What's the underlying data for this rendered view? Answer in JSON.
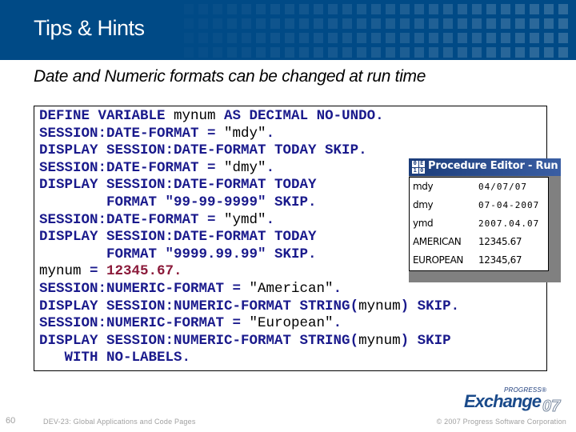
{
  "header": {
    "title": "Tips & Hints",
    "background_color": "#004a86"
  },
  "subtitle": "Date and Numeric formats can be changed at run time",
  "code": {
    "lines": [
      [
        {
          "t": "DEFINE VARIABLE ",
          "c": "kw"
        },
        {
          "t": "mynum",
          "c": "id"
        },
        {
          "t": " AS DECIMAL NO-UNDO.",
          "c": "kw"
        }
      ],
      [
        {
          "t": "SESSION:DATE-FORMAT = ",
          "c": "kw"
        },
        {
          "t": "\"mdy\"",
          "c": "str"
        },
        {
          "t": ".",
          "c": "kw"
        }
      ],
      [
        {
          "t": "DISPLAY SESSION:DATE-FORMAT TODAY SKIP.",
          "c": "kw"
        }
      ],
      [
        {
          "t": "SESSION:DATE-FORMAT = ",
          "c": "kw"
        },
        {
          "t": "\"dmy\"",
          "c": "str"
        },
        {
          "t": ".",
          "c": "kw"
        }
      ],
      [
        {
          "t": "DISPLAY SESSION:DATE-FORMAT TODAY",
          "c": "kw"
        }
      ],
      [
        {
          "t": "        FORMAT \"99-99-9999\" SKIP.",
          "c": "fmt"
        }
      ],
      [
        {
          "t": "SESSION:DATE-FORMAT = ",
          "c": "kw"
        },
        {
          "t": "\"ymd\"",
          "c": "str"
        },
        {
          "t": ".",
          "c": "kw"
        }
      ],
      [
        {
          "t": "DISPLAY SESSION:DATE-FORMAT TODAY",
          "c": "kw"
        }
      ],
      [
        {
          "t": "        FORMAT \"9999.99.99\" SKIP.",
          "c": "fmt"
        }
      ],
      [
        {
          "t": "mynum",
          "c": "id"
        },
        {
          "t": " = ",
          "c": "kw"
        },
        {
          "t": "12345.67.",
          "c": "num"
        }
      ],
      [
        {
          "t": "SESSION:NUMERIC-FORMAT = ",
          "c": "kw"
        },
        {
          "t": "\"American\"",
          "c": "str"
        },
        {
          "t": ".",
          "c": "kw"
        }
      ],
      [
        {
          "t": "DISPLAY SESSION:NUMERIC-FORMAT STRING(",
          "c": "kw"
        },
        {
          "t": "mynum",
          "c": "id"
        },
        {
          "t": ") SKIP.",
          "c": "kw"
        }
      ],
      [
        {
          "t": "SESSION:NUMERIC-FORMAT = ",
          "c": "kw"
        },
        {
          "t": "\"European\"",
          "c": "str"
        },
        {
          "t": ".",
          "c": "kw"
        }
      ],
      [
        {
          "t": "DISPLAY SESSION:NUMERIC-FORMAT STRING(",
          "c": "kw"
        },
        {
          "t": "mynum",
          "c": "id"
        },
        {
          "t": ") SKIP",
          "c": "kw"
        }
      ],
      [
        {
          "t": "   WITH NO-LABELS.",
          "c": "kw"
        }
      ]
    ],
    "colors": {
      "keyword": "#1a1a8c",
      "identifier": "#000000",
      "number_literal": "#8b1a3a"
    }
  },
  "procedure_window": {
    "icon": "progress-0e10-icon",
    "icon_glyphs": [
      "0",
      "E",
      "1",
      "0"
    ],
    "title": "Procedure Editor - Run",
    "rows": [
      {
        "label": "mdy",
        "value": "04/07/07",
        "style": "mono"
      },
      {
        "label": "dmy",
        "value": "07-04-2007",
        "style": "mono"
      },
      {
        "label": "ymd",
        "value": "2007.04.07",
        "style": "mono"
      },
      {
        "label": "AMERICAN",
        "value": "12345.67",
        "style": "prop"
      },
      {
        "label": "EUROPEAN",
        "value": "12345,67",
        "style": "prop"
      }
    ]
  },
  "footer": {
    "page_number": "60",
    "session": "DEV-23: Global Applications and Code Pages",
    "copyright": "© 2007 Progress Software Corporation",
    "logo": {
      "brand": "PROGRESS®",
      "name": "Exchange",
      "year": "07"
    }
  }
}
